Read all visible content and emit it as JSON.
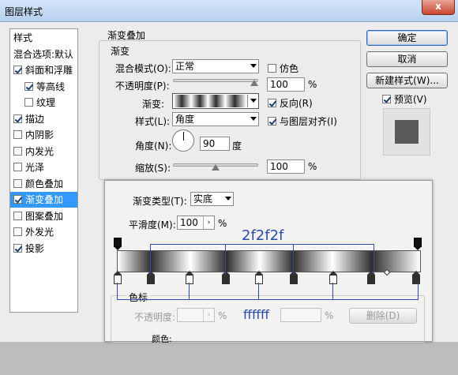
{
  "window": {
    "title": "图层样式",
    "close_label": "x"
  },
  "left_panel": {
    "items": [
      {
        "label": "样式",
        "checkbox": false,
        "checked": false,
        "selected": false,
        "indent": false
      },
      {
        "label": "混合选项:默认",
        "checkbox": false,
        "checked": false,
        "selected": false,
        "indent": false
      },
      {
        "label": "斜面和浮雕",
        "checkbox": true,
        "checked": true,
        "selected": false,
        "indent": false
      },
      {
        "label": "等高线",
        "checkbox": true,
        "checked": true,
        "selected": false,
        "indent": true
      },
      {
        "label": "纹理",
        "checkbox": true,
        "checked": false,
        "selected": false,
        "indent": true
      },
      {
        "label": "描边",
        "checkbox": true,
        "checked": true,
        "selected": false,
        "indent": false
      },
      {
        "label": "内阴影",
        "checkbox": true,
        "checked": false,
        "selected": false,
        "indent": false
      },
      {
        "label": "内发光",
        "checkbox": true,
        "checked": false,
        "selected": false,
        "indent": false
      },
      {
        "label": "光泽",
        "checkbox": true,
        "checked": false,
        "selected": false,
        "indent": false
      },
      {
        "label": "颜色叠加",
        "checkbox": true,
        "checked": false,
        "selected": false,
        "indent": false
      },
      {
        "label": "渐变叠加",
        "checkbox": true,
        "checked": true,
        "selected": true,
        "indent": false
      },
      {
        "label": "图案叠加",
        "checkbox": true,
        "checked": false,
        "selected": false,
        "indent": false
      },
      {
        "label": "外发光",
        "checkbox": true,
        "checked": false,
        "selected": false,
        "indent": false
      },
      {
        "label": "投影",
        "checkbox": true,
        "checked": true,
        "selected": false,
        "indent": false
      }
    ]
  },
  "gradient_overlay": {
    "section_title": "渐变叠加",
    "group_title": "渐变",
    "blend_mode_label": "混合模式(O):",
    "blend_mode_value": "正常",
    "dither_label": "仿色",
    "opacity_label": "不透明度(P):",
    "opacity_value": "100",
    "opacity_unit": "%",
    "opacity_level": 1.0,
    "gradient_label": "渐变:",
    "reverse_label": "反向(R)",
    "style_label": "样式(L):",
    "style_value": "角度",
    "align_label": "与图层对齐(I)",
    "angle_label": "角度(N):",
    "angle_value": "90",
    "angle_unit": "度",
    "scale_label": "缩放(S):",
    "scale_value": "100",
    "scale_unit": "%",
    "scale_level": 0.5
  },
  "buttons": {
    "ok": "确定",
    "cancel": "取消",
    "new_style": "新建样式(W)...",
    "preview": "预览(V)"
  },
  "gradient_editor": {
    "type_label": "渐变类型(T):",
    "type_value": "实底",
    "smooth_label": "平滑度(M):",
    "smooth_value": "100",
    "smooth_unit": "%",
    "color_stops_title": "色标",
    "stop_opacity_label": "不透明度:",
    "stop_opacity_unit": "%",
    "location_unit": "%",
    "delete_label": "删除(D)",
    "color_label": "颜色:"
  },
  "annotations": {
    "dark_color": "2f2f2f",
    "light_color": "ffffff"
  },
  "colors": {
    "accent": "#3399ff",
    "annotation": "#2e4aa8",
    "dark_stop": "#2f2f2f",
    "light_stop": "#ffffff"
  }
}
